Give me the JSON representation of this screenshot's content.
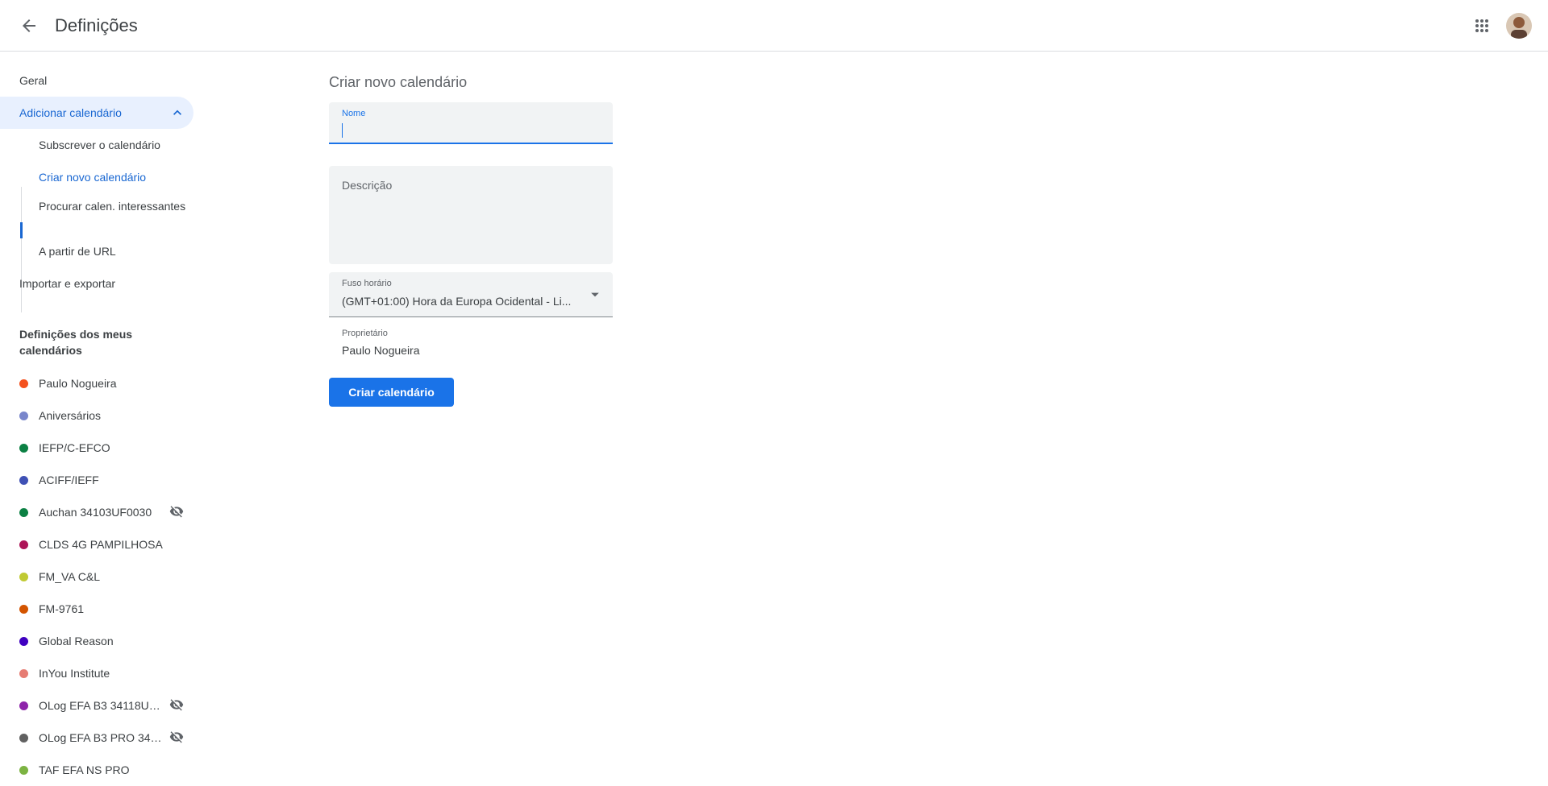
{
  "header": {
    "title": "Definições"
  },
  "sidebar": {
    "nav": [
      {
        "label": "Geral"
      },
      {
        "label": "Adicionar calendário"
      },
      {
        "label": "Importar e exportar"
      }
    ],
    "add_calendar_items": [
      {
        "label": "Subscrever o calendário"
      },
      {
        "label": "Criar novo calendário"
      },
      {
        "label": "Procurar calen. interessantes"
      },
      {
        "label": "A partir de URL"
      }
    ],
    "my_calendars_title": "Definições dos meus calendários",
    "calendars": [
      {
        "label": "Paulo Nogueira",
        "color": "#f4511e",
        "hidden": false
      },
      {
        "label": "Aniversários",
        "color": "#7986cb",
        "hidden": false
      },
      {
        "label": "IEFP/C-EFCO",
        "color": "#0b8043",
        "hidden": false
      },
      {
        "label": "ACIFF/IEFF",
        "color": "#3f51b5",
        "hidden": false
      },
      {
        "label": "Auchan 34103UF0030",
        "color": "#0b8043",
        "hidden": true
      },
      {
        "label": "CLDS 4G PAMPILHOSA",
        "color": "#ad1457",
        "hidden": false
      },
      {
        "label": "FM_VA C&L",
        "color": "#c0ca33",
        "hidden": false
      },
      {
        "label": "FM-9761",
        "color": "#d35400",
        "hidden": false
      },
      {
        "label": "Global Reason",
        "color": "#3f00c0",
        "hidden": false
      },
      {
        "label": "InYou Institute",
        "color": "#e67c73",
        "hidden": false
      },
      {
        "label": "OLog EFA B3 34118UF…",
        "color": "#8e24aa",
        "hidden": true
      },
      {
        "label": "OLog EFA B3 PRO 3411…",
        "color": "#616161",
        "hidden": true
      },
      {
        "label": "TAF EFA NS PRO",
        "color": "#7cb342",
        "hidden": false
      }
    ]
  },
  "form": {
    "heading": "Criar novo calendário",
    "name_label": "Nome",
    "name_value": "",
    "description_label": "Descrição",
    "timezone_label": "Fuso horário",
    "timezone_value": "(GMT+01:00) Hora da Europa Ocidental - Li...",
    "owner_label": "Proprietário",
    "owner_value": "Paulo Nogueira",
    "submit_label": "Criar calendário"
  },
  "colors": {
    "accent": "#1a73e8",
    "active_bg": "#e8f0fe",
    "active_text": "#1967d2"
  }
}
